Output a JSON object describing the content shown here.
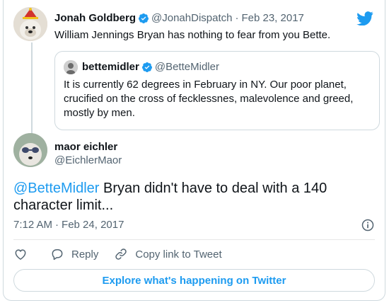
{
  "parent_tweet": {
    "author_name": "Jonah Goldberg",
    "author_handle": "@JonahDispatch",
    "separator": "·",
    "date": "Feb 23, 2017",
    "text": "William Jennings Bryan has nothing to fear from you Bette."
  },
  "quoted_tweet": {
    "author_name": "bettemidler",
    "author_handle": "@BetteMidler",
    "text": "It is currently 62 degrees in February in NY.  Our poor planet, crucified on the cross of fecklessnes, malevolence and greed, mostly by men."
  },
  "main_tweet": {
    "author_name": "maor eichler",
    "author_handle": "@EichlerMaor",
    "mention": "@BetteMidler",
    "text": " Bryan didn't have to deal with a 140 character limit...",
    "time": "7:12 AM",
    "separator": "·",
    "date": "Feb 24, 2017"
  },
  "actions": {
    "like_icon": "heart-icon",
    "reply_label": "Reply",
    "copy_link_label": "Copy link to Tweet"
  },
  "explore_label": "Explore what's happening on Twitter",
  "colors": {
    "accent": "#1d9bf0",
    "muted": "#536471",
    "border": "#cfd9de"
  }
}
